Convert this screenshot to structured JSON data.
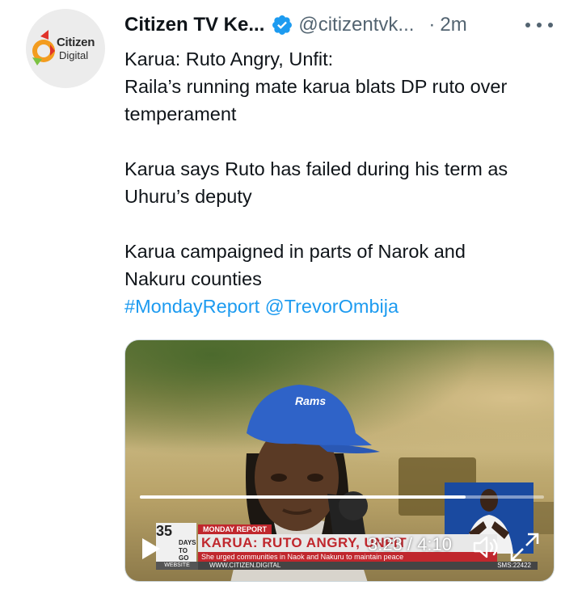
{
  "author": {
    "display_name": "Citizen TV Ke...",
    "handle": "@citizentvk...",
    "separator": "·",
    "timestamp": "2m",
    "avatar": {
      "brand_line1": "Citizen",
      "brand_line2": "Digital"
    },
    "verified_icon": "verified-badge-icon"
  },
  "tweet": {
    "lines": [
      "Karua: Ruto Angry, Unfit:",
      "Raila’s running mate karua blats DP ruto over",
      "temperament",
      "Karua says Ruto has failed during his term as",
      "Uhuru’s deputy",
      "Karua campaigned in parts of Narok and",
      "Nakuru counties"
    ],
    "hashtag": "#MondayReport",
    "mention": "@TrevorOmbija"
  },
  "video": {
    "cap_text": "Rams",
    "badge_label": "MONDAY REPORT",
    "headline": "KARUA: RUTO ANGRY, UNFIT",
    "subline": "She urged communities in Naok and Nakuru to maintain peace",
    "website_label": "WEBSITE",
    "website_url": "WWW.CITIZEN.DIGITAL",
    "sms": "SMS:22422",
    "countdown_number": "35",
    "countdown_days": "DAYS",
    "countdown_togo": "TO GO",
    "current_time": "3:23",
    "duration": "4:10",
    "timecode": "3:23 / 4:10",
    "progress_fraction": 0.806
  },
  "colors": {
    "link": "#1d9bf0",
    "secondary_text": "#536471",
    "verified": "#1d9bf0",
    "brand_red": "#c0272d"
  }
}
